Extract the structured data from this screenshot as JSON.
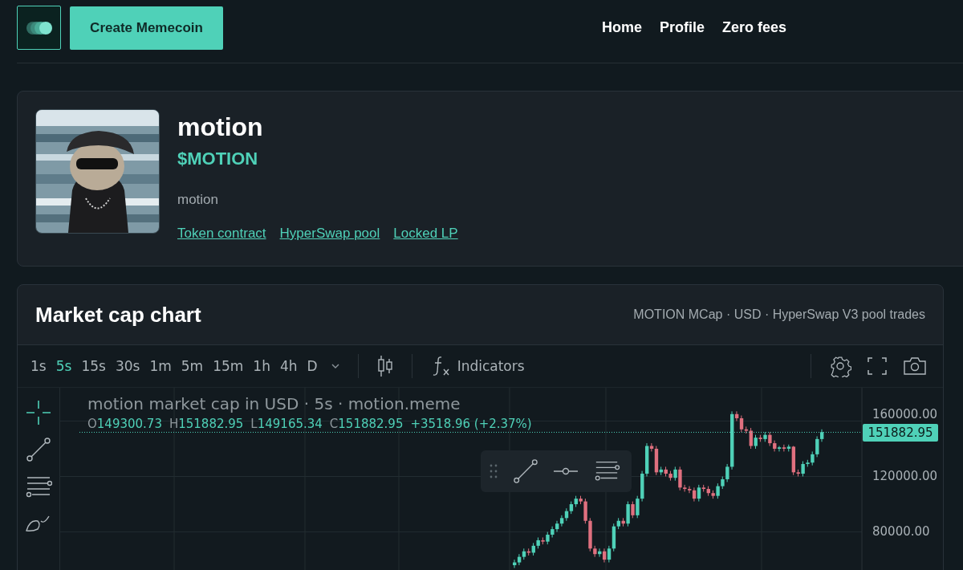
{
  "header": {
    "create_button": "Create Memecoin",
    "nav": [
      "Home",
      "Profile",
      "Zero fees"
    ]
  },
  "token": {
    "name": "motion",
    "ticker": "$MOTION",
    "description": "motion",
    "links": [
      "Token contract",
      "HyperSwap pool",
      "Locked LP"
    ]
  },
  "chart_card": {
    "title": "Market cap chart",
    "subtitle": "MOTION MCap · USD · HyperSwap V3 pool trades",
    "intervals": [
      {
        "label": "1s",
        "selected": false
      },
      {
        "label": "5s",
        "selected": true
      },
      {
        "label": "15s",
        "selected": false
      },
      {
        "label": "30s",
        "selected": false
      },
      {
        "label": "1m",
        "selected": false
      },
      {
        "label": "5m",
        "selected": false
      },
      {
        "label": "15m",
        "selected": false
      },
      {
        "label": "1h",
        "selected": false
      },
      {
        "label": "4h",
        "selected": false
      },
      {
        "label": "D",
        "selected": false
      }
    ],
    "indicators_button": "Indicators",
    "legend": {
      "title": "motion market cap in USD · 5s · motion.meme",
      "ohlc": [
        {
          "key": "O",
          "value": "149300.73"
        },
        {
          "key": "H",
          "value": "151882.95"
        },
        {
          "key": "L",
          "value": "149165.34"
        },
        {
          "key": "C",
          "value": "151882.95"
        }
      ],
      "change": "+3518.96 (+2.37%)"
    },
    "chart_data": {
      "type": "candlestick",
      "grid": true,
      "ylim": [
        45000,
        184000
      ],
      "yticks": [
        {
          "value": 80000,
          "label": "80000.00"
        },
        {
          "value": 120000,
          "label": "120000.00"
        },
        {
          "value": 160000,
          "label": "160000.00"
        }
      ],
      "ref_lines": [
        {
          "axis": "y",
          "value": 151882.95,
          "label": "151882.95",
          "color": "#4fd1b8"
        }
      ],
      "ohlc": [
        [
          56000,
          60000,
          54000,
          58000
        ],
        [
          58000,
          64000,
          56000,
          62000
        ],
        [
          62000,
          68000,
          60000,
          66000
        ],
        [
          66000,
          68000,
          63000,
          65000
        ],
        [
          65000,
          72000,
          63000,
          70000
        ],
        [
          70000,
          76000,
          68000,
          74000
        ],
        [
          74000,
          76000,
          71000,
          73000
        ],
        [
          73000,
          80000,
          71000,
          78000
        ],
        [
          78000,
          84000,
          76000,
          82000
        ],
        [
          82000,
          88000,
          80000,
          86000
        ],
        [
          86000,
          92000,
          84000,
          90000
        ],
        [
          90000,
          97000,
          88000,
          95000
        ],
        [
          95000,
          102000,
          93000,
          100000
        ],
        [
          100000,
          106000,
          98000,
          104000
        ],
        [
          104000,
          106000,
          100000,
          102000
        ],
        [
          102000,
          104000,
          86000,
          88000
        ],
        [
          88000,
          90000,
          66000,
          68000
        ],
        [
          68000,
          70000,
          62000,
          64000
        ],
        [
          64000,
          68000,
          62000,
          66000
        ],
        [
          66000,
          68000,
          58000,
          60000
        ],
        [
          60000,
          70000,
          58000,
          68000
        ],
        [
          68000,
          86000,
          66000,
          84000
        ],
        [
          84000,
          90000,
          82000,
          88000
        ],
        [
          88000,
          90000,
          84000,
          86000
        ],
        [
          86000,
          102000,
          84000,
          100000
        ],
        [
          100000,
          102000,
          90000,
          92000
        ],
        [
          92000,
          106000,
          90000,
          104000
        ],
        [
          104000,
          124000,
          102000,
          122000
        ],
        [
          122000,
          144000,
          120000,
          142000
        ],
        [
          142000,
          144000,
          138000,
          140000
        ],
        [
          140000,
          142000,
          121000,
          123000
        ],
        [
          123000,
          127000,
          121000,
          125000
        ],
        [
          125000,
          127000,
          120000,
          122000
        ],
        [
          122000,
          124000,
          117000,
          119000
        ],
        [
          119000,
          127000,
          117000,
          125000
        ],
        [
          125000,
          127000,
          110000,
          112000
        ],
        [
          112000,
          114000,
          109000,
          111000
        ],
        [
          111000,
          113000,
          108000,
          110000
        ],
        [
          110000,
          112000,
          102000,
          104000
        ],
        [
          104000,
          114000,
          102000,
          112000
        ],
        [
          112000,
          114000,
          109000,
          111000
        ],
        [
          111000,
          113000,
          106000,
          108000
        ],
        [
          108000,
          110000,
          104000,
          106000
        ],
        [
          106000,
          115000,
          104000,
          113000
        ],
        [
          113000,
          120000,
          111000,
          118000
        ],
        [
          118000,
          129000,
          116000,
          127000
        ],
        [
          127000,
          167000,
          125000,
          165000
        ],
        [
          165000,
          167000,
          160000,
          162000
        ],
        [
          162000,
          164000,
          152000,
          154000
        ],
        [
          154000,
          156000,
          151000,
          153000
        ],
        [
          153000,
          155000,
          140000,
          142000
        ],
        [
          142000,
          150000,
          140000,
          148000
        ],
        [
          148000,
          150000,
          145000,
          147000
        ],
        [
          147000,
          152000,
          145000,
          150000
        ],
        [
          150000,
          152000,
          142000,
          144000
        ],
        [
          144000,
          146000,
          138000,
          140000
        ],
        [
          140000,
          142000,
          138000,
          141000
        ],
        [
          141000,
          143000,
          138000,
          140000
        ],
        [
          140000,
          143000,
          138000,
          141500
        ],
        [
          141500,
          142000,
          121000,
          123000
        ],
        [
          123000,
          125000,
          120000,
          122000
        ],
        [
          122000,
          131000,
          120000,
          129000
        ],
        [
          129000,
          132000,
          127000,
          130000
        ],
        [
          130000,
          138000,
          128000,
          136000
        ],
        [
          136000,
          149000,
          134000,
          147000
        ],
        [
          147000,
          154000,
          145000,
          152000
        ]
      ]
    }
  }
}
